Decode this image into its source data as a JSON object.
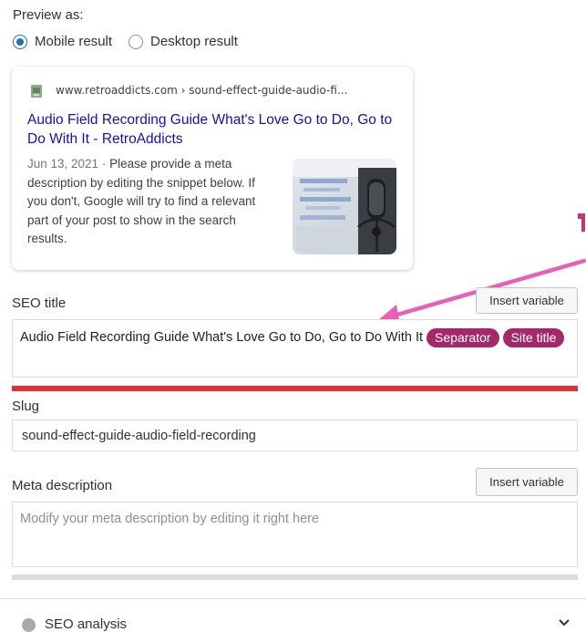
{
  "preview": {
    "label": "Preview as:",
    "options": [
      "Mobile result",
      "Desktop result"
    ],
    "selected": "Mobile result"
  },
  "snippet": {
    "url": "www.retroaddicts.com › sound-effect-guide-audio-fi...",
    "title": "Audio Field Recording Guide What's Love Go to Do, Go to Do With It - RetroAddicts",
    "date": "Jun 13, 2021",
    "date_separator": " · ",
    "description": "Please provide a meta description by editing the snippet below. If you don't, Google will try to find a relevant part of your post to show in the search results."
  },
  "seo_title": {
    "label": "SEO title",
    "insert_button": "Insert variable",
    "text": "Audio Field Recording Guide What's Love Go to Do, Go to Do With It",
    "variables": [
      "Separator",
      "Site title"
    ],
    "length_progress": 1.0
  },
  "slug": {
    "label": "Slug",
    "value": "sound-effect-guide-audio-field-recording"
  },
  "meta_description": {
    "label": "Meta description",
    "insert_button": "Insert variable",
    "placeholder": "Modify your meta description by editing it right here"
  },
  "accordion": {
    "seo_analysis": "SEO analysis"
  },
  "colors": {
    "link": "#1a0dab",
    "accent": "#2271b1",
    "pill": "#a4286a",
    "progress_bad": "#dc3232",
    "annotation_arrow": "#e85fb6"
  }
}
